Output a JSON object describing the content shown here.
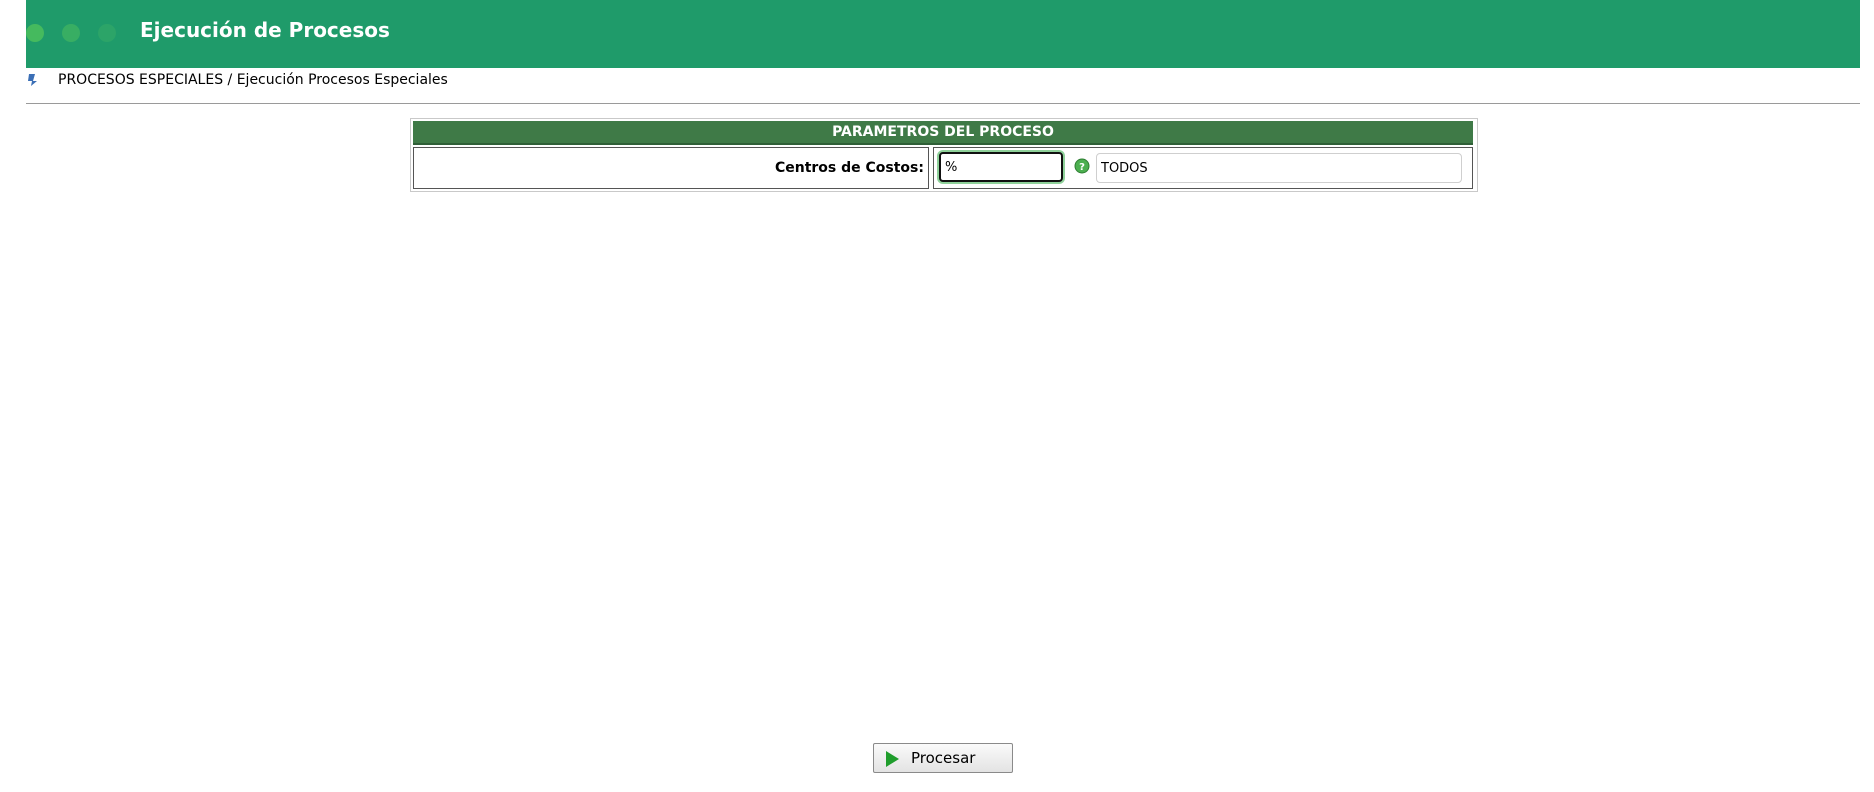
{
  "header": {
    "title": "Ejecución de Procesos",
    "color": "#1f9b6a"
  },
  "breadcrumb": {
    "text": "PROCESOS ESPECIALES / Ejecución Procesos Especiales",
    "icon": "info-icon"
  },
  "panel": {
    "title": "PARAMETROS DEL PROCESO",
    "header_color": "#3f7a47",
    "fields": [
      {
        "label": "Centros de Costos:",
        "code_value": "%",
        "help_icon": "help-icon",
        "description_value": "TODOS"
      }
    ]
  },
  "actions": {
    "process_label": "Procesar",
    "process_icon": "play-icon"
  }
}
